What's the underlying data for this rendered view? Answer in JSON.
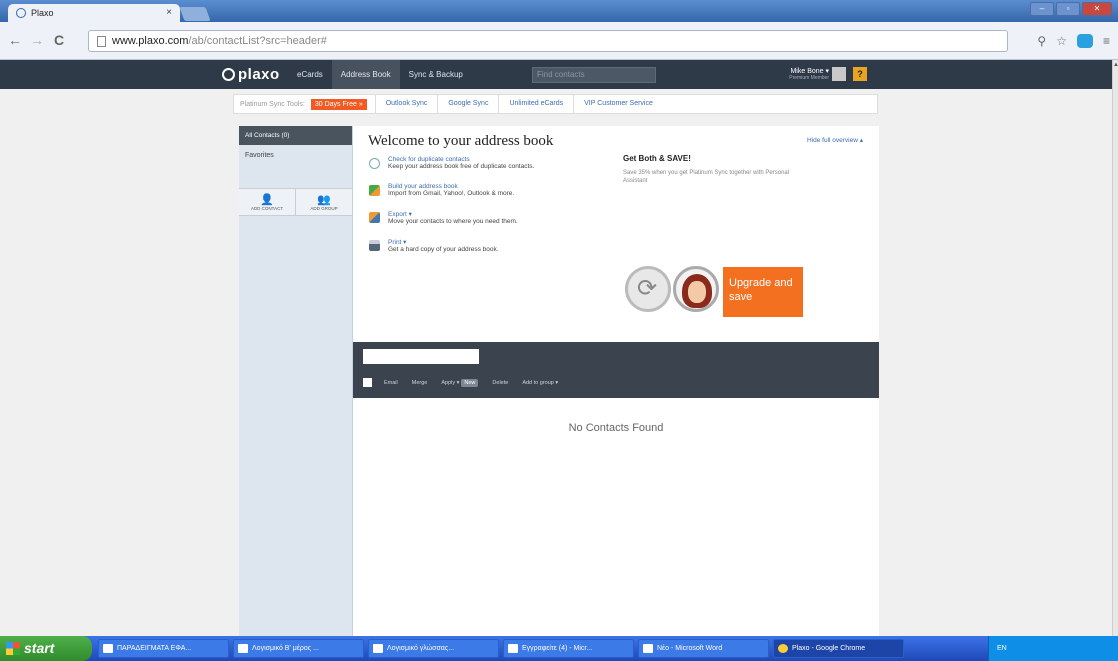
{
  "browser": {
    "tab_title": "Plaxo",
    "tab_close": "×",
    "url_host": "www.plaxo.com",
    "url_rest": "/ab/contactList?src=header#",
    "win_min": "–",
    "win_max": "▫",
    "win_close": "✕"
  },
  "header": {
    "logo": "plaxo",
    "nav": [
      "eCards",
      "Address Book",
      "Sync & Backup"
    ],
    "search_placeholder": "Find contacts",
    "user_name": "Mike Bone ▾",
    "user_sub": "Premium Member",
    "help": "?"
  },
  "promo": {
    "label": "Platinum Sync Tools:",
    "trial": "30 Days Free »",
    "items": [
      "Outlook Sync",
      "Google Sync",
      "Unlimited eCards",
      "VIP Customer Service"
    ]
  },
  "sidebar": {
    "all_contacts": "All Contacts (0)",
    "favorites": "Favorites",
    "add_contact": "ADD CONTACT",
    "add_group": "ADD GROUP"
  },
  "main": {
    "welcome": "Welcome to your address book",
    "hide_link": "Hide full overview ▴",
    "tips": [
      {
        "title": "Check for duplicate contacts",
        "desc": "Keep your address book free of duplicate contacts."
      },
      {
        "title": "Build your address book",
        "desc": "Import from Gmail, Yahoo!, Outlook & more."
      },
      {
        "title": "Export ▾",
        "desc": "Move your contacts to where you need them."
      },
      {
        "title": "Print ▾",
        "desc": "Get a hard copy of your address book."
      }
    ],
    "both_title": "Get Both & SAVE!",
    "both_text": "Save 35% when you get Platinum Sync together with Personal Assistant",
    "upgrade": "Upgrade and save",
    "actions": [
      "Email",
      "Merge",
      "Apply ▾",
      "Delete",
      "Add to group ▾"
    ],
    "apply_badge": "New",
    "no_contacts": "No Contacts Found"
  },
  "taskbar": {
    "start": "start",
    "tasks": [
      "ΠΑΡΑΔΕΙΓΜΑΤΑ ΕΦΑ...",
      "Λογισμικό Β' μέρος ...",
      "Λογισμικό γλώσσας...",
      "Εγγραφείτε (4) - Micr...",
      "Νέο - Microsoft Word",
      "Plaxo - Google Chrome"
    ],
    "tray": "EN"
  },
  "colors": {
    "accent": "#f37021",
    "topbar": "#2e3a47",
    "link": "#3b6db1"
  }
}
